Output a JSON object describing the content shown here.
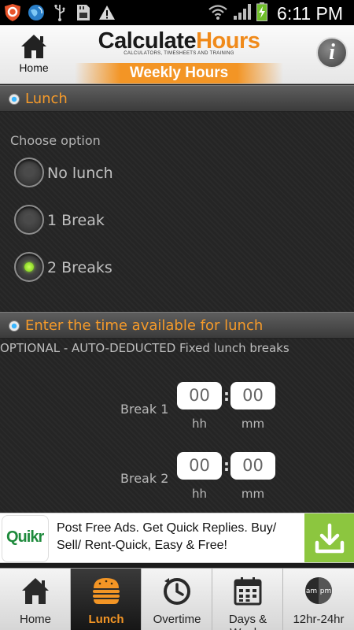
{
  "status_bar": {
    "time": "6:11 PM",
    "left_icons": [
      "app-shield-icon",
      "browser-globe-icon",
      "usb-icon",
      "sd-card-icon",
      "warning-icon"
    ],
    "right_icons": [
      "wifi-icon",
      "signal-icon",
      "battery-charging-icon"
    ]
  },
  "header": {
    "home_label": "Home",
    "logo_part1": "Calculate",
    "logo_part2": "Hours",
    "logo_tagline": "CALCULATORS, TIMESHEETS AND TRAINING",
    "page_title": "Weekly Hours",
    "info_glyph": "i",
    "colors": {
      "brand_orange": "#f39525",
      "logo_dark": "#1a1a1a"
    }
  },
  "lunch_section": {
    "title": "Lunch",
    "choose_label": "Choose option",
    "options": [
      {
        "label": "No lunch",
        "selected": false
      },
      {
        "label": "1 Break",
        "selected": false
      },
      {
        "label": "2 Breaks",
        "selected": true
      }
    ]
  },
  "time_section": {
    "title": "Enter the time available for lunch",
    "note": "OPTIONAL - AUTO-DEDUCTED Fixed lunch breaks",
    "breaks": [
      {
        "label": "Break 1",
        "hh": "00",
        "mm": "00",
        "hh_label": "hh",
        "mm_label": "mm",
        "separator": ":"
      },
      {
        "label": "Break 2",
        "hh": "00",
        "mm": "00",
        "hh_label": "hh",
        "mm_label": "mm",
        "separator": ":"
      }
    ]
  },
  "ad": {
    "logo_text": "Quikr",
    "text": "Post Free Ads. Get Quick Replies. Buy/ Sell/ Rent-Quick, Easy & Free!",
    "action_icon": "download-icon",
    "colors": {
      "action_bg": "#8cc63f",
      "logo_green": "#1e8a3c"
    }
  },
  "tabs": [
    {
      "label": "Home",
      "icon": "home-icon",
      "active": false
    },
    {
      "label": "Lunch",
      "icon": "burger-icon",
      "active": true
    },
    {
      "label": "Overtime",
      "icon": "clock-icon",
      "active": false
    },
    {
      "label": "Days & Weeks",
      "icon": "calendar-icon",
      "active": false
    },
    {
      "label": "12hr-24hr",
      "icon": "am-pm-icon",
      "active": false
    }
  ],
  "colors": {
    "section_title": "#f59a2a",
    "radio_selected": "#8fe02a",
    "background": "#252525"
  }
}
